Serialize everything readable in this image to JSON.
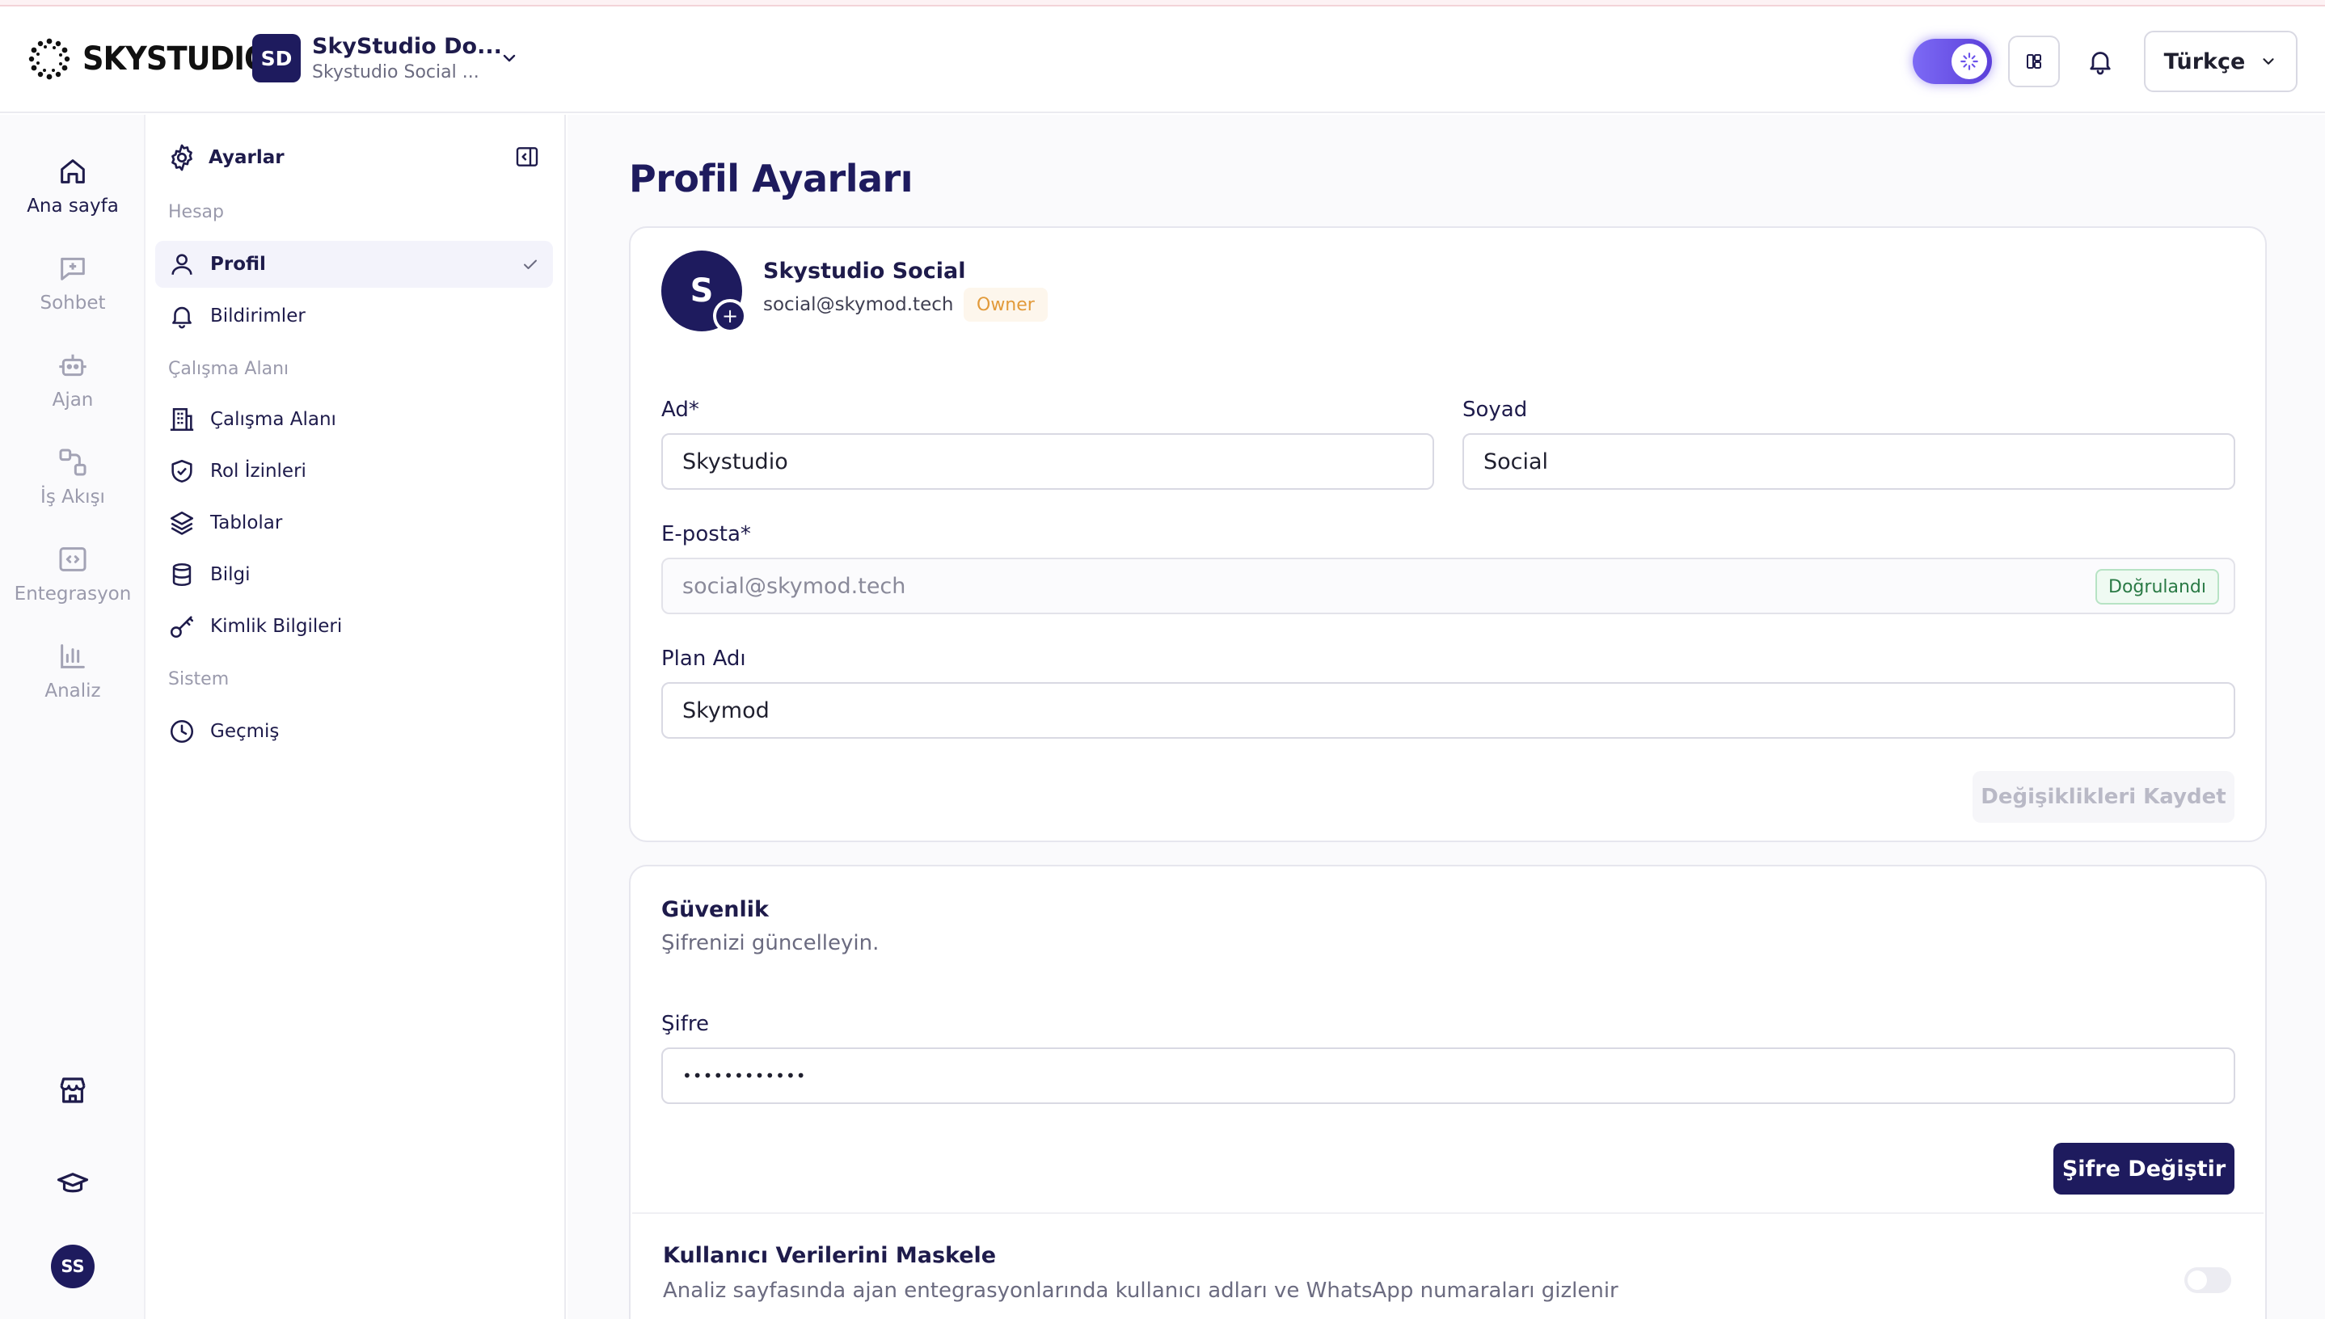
{
  "header": {
    "logo_text": "SKYSTUDIO",
    "workspace": {
      "badge": "SD",
      "title": "SkyStudio Do...",
      "subtitle": "Skystudio Social ..."
    },
    "language": "Türkçe"
  },
  "rail": {
    "items": [
      {
        "label": "Ana sayfa",
        "icon": "home-icon"
      },
      {
        "label": "Sohbet",
        "icon": "chat-add-icon"
      },
      {
        "label": "Ajan",
        "icon": "bot-icon"
      },
      {
        "label": "İş Akışı",
        "icon": "workflow-icon"
      },
      {
        "label": "Entegrasyon",
        "icon": "code-icon"
      },
      {
        "label": "Analiz",
        "icon": "chart-icon"
      }
    ],
    "user_initials": "SS"
  },
  "settings_sidebar": {
    "title": "Ayarlar",
    "sections": {
      "account": "Hesap",
      "workspace": "Çalışma Alanı",
      "system": "Sistem"
    },
    "items": {
      "profile": "Profil",
      "notifications": "Bildirimler",
      "workspace": "Çalışma Alanı",
      "role_permissions": "Rol İzinleri",
      "tables": "Tablolar",
      "knowledge": "Bilgi",
      "credentials": "Kimlik Bilgileri",
      "history": "Geçmiş"
    }
  },
  "page": {
    "title": "Profil Ayarları",
    "profile": {
      "avatar_letter": "S",
      "name": "Skystudio Social",
      "email": "social@skymod.tech",
      "role_badge": "Owner"
    },
    "form": {
      "first_name_label": "Ad*",
      "first_name_value": "Skystudio",
      "last_name_label": "Soyad",
      "last_name_value": "Social",
      "email_label": "E-posta*",
      "email_value": "social@skymod.tech",
      "email_verified": "Doğrulandı",
      "plan_label": "Plan Adı",
      "plan_value": "Skymod",
      "save_button": "Değişiklikleri Kaydet"
    },
    "security": {
      "title": "Güvenlik",
      "description": "Şifrenizi güncelleyin.",
      "password_label": "Şifre",
      "password_value": "••••••••••••",
      "change_button": "Şifre Değiştir"
    },
    "mask": {
      "title": "Kullanıcı Verilerini Maskele",
      "description": "Analiz sayfasında ajan entegrasyonlarında kullanıcı adları ve WhatsApp numaraları gizlenir",
      "enabled": false
    }
  },
  "colors": {
    "brand": "#1e1b5e",
    "accent": "#6c54eb",
    "owner_badge": "#e29a3a",
    "verified": "#2a7a45"
  }
}
